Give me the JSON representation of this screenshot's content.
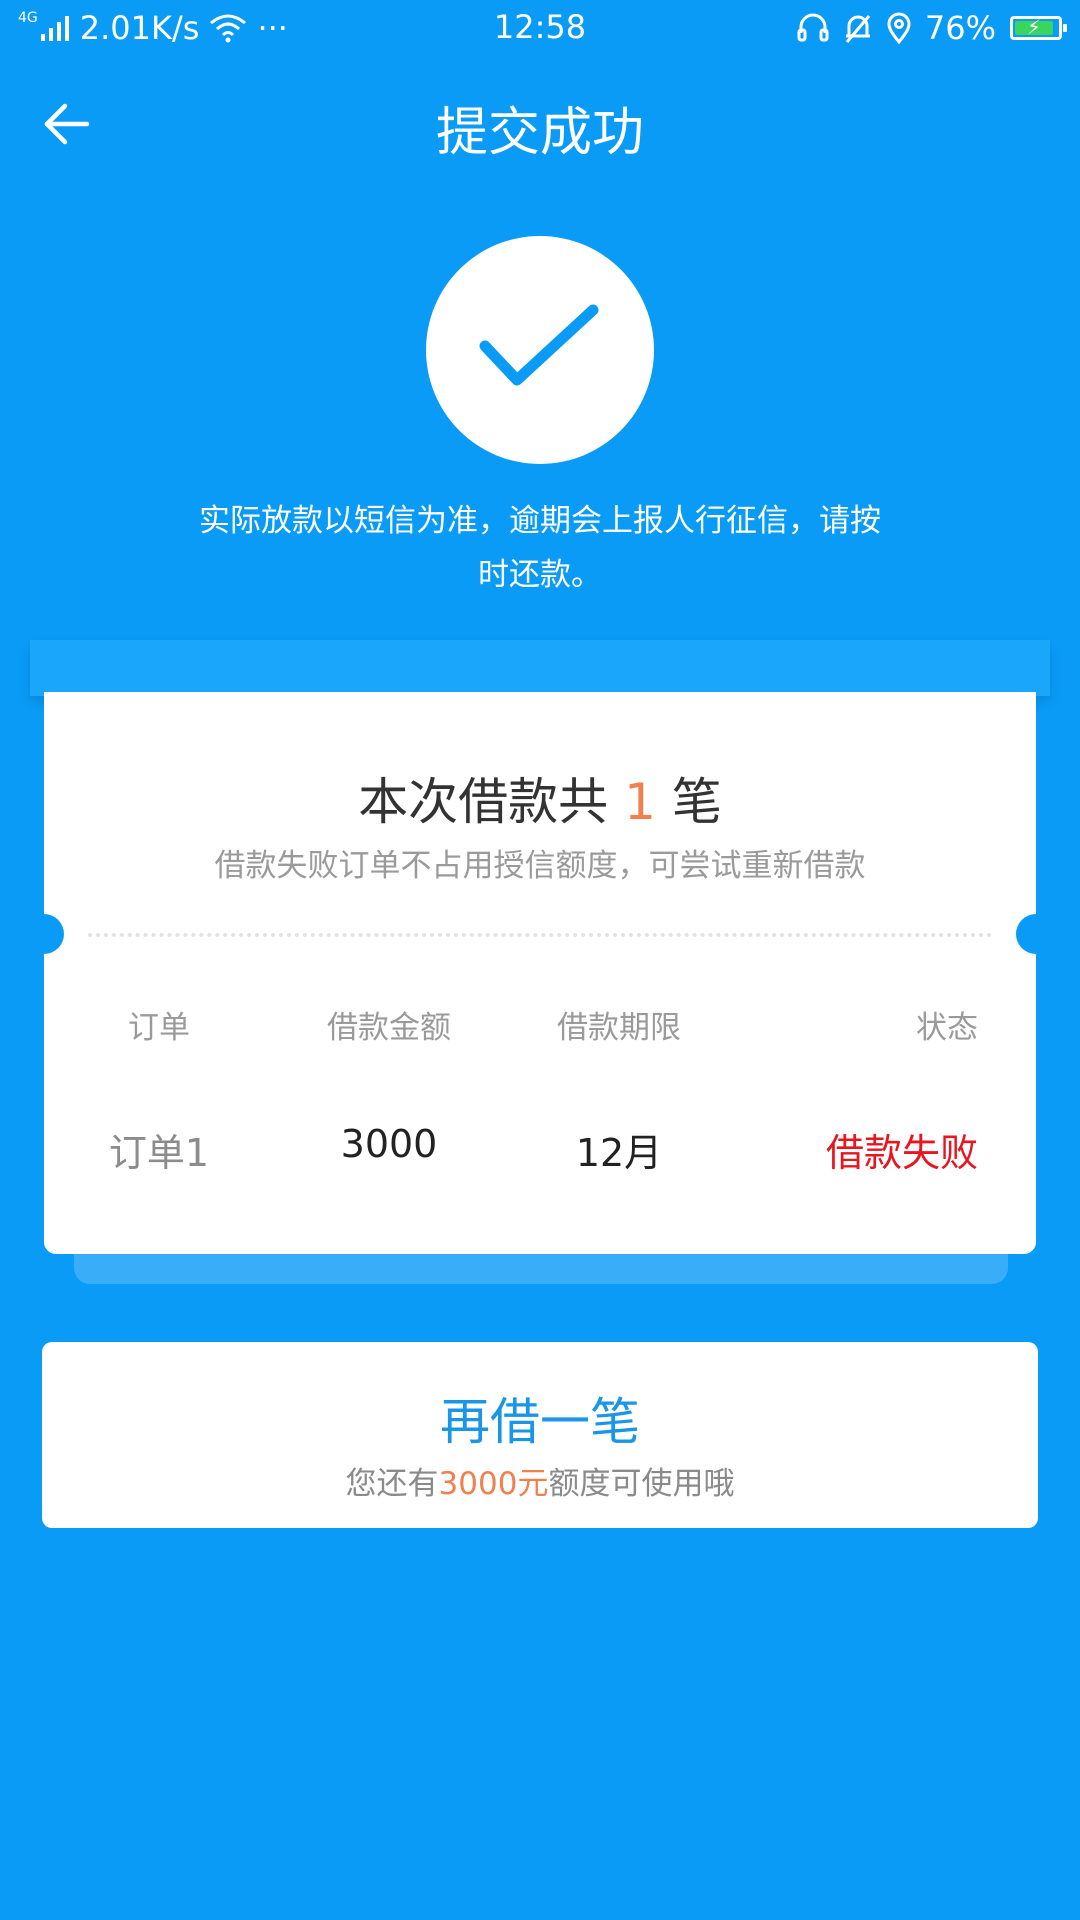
{
  "status_bar": {
    "network": "4G",
    "speed": "2.01K/s",
    "more": "···",
    "time": "12:58",
    "battery": "76%"
  },
  "header": {
    "title": "提交成功"
  },
  "notice": {
    "line1": "实际放款以短信为准，逾期会上报人行征信，请按",
    "line2": "时还款。"
  },
  "summary": {
    "title_prefix": "本次借款共",
    "count": "1",
    "title_suffix": "笔",
    "subtitle": "借款失败订单不占用授信额度，可尝试重新借款"
  },
  "table": {
    "headers": [
      "订单",
      "借款金额",
      "借款期限",
      "状态"
    ],
    "rows": [
      {
        "order": "订单1",
        "amount": "3000",
        "term": "12月",
        "status": "借款失败"
      }
    ]
  },
  "borrow_again": {
    "title": "再借一笔",
    "sub_prefix": "您还有",
    "amount": "3000元",
    "sub_suffix": "额度可使用哦"
  },
  "colors": {
    "background": "#0A9BF7",
    "accent_orange": "#F0814E",
    "status_failed": "#E8161E",
    "button_text": "#1A96E8"
  }
}
